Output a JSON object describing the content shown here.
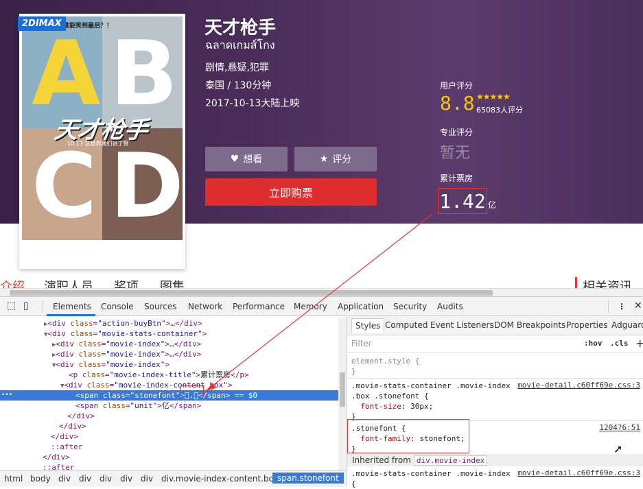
{
  "movie": {
    "badge": "2DIMAX",
    "poster_tagline": "谁能笑到最后？！",
    "poster_title": "天才枪手",
    "poster_date": "10.13 这世界我们说了算",
    "poster_letters": [
      "A",
      "B",
      "C",
      "D"
    ],
    "title_cn": "天才枪手",
    "title_th": "ฉลาดเกมส์โกง",
    "genres": "剧情,悬疑,犯罪",
    "country_runtime": "泰国 / 130分钟",
    "release": "2017-10-13大陆上映",
    "want_btn": "想看",
    "rate_btn": "评分",
    "buy_btn": "立即购票",
    "user_score_label": "用户评分",
    "user_score": "8.8",
    "stars": "★★★★★",
    "score_count": "65083人评分",
    "pro_score_label": "专业评分",
    "pro_score": "暂无",
    "boxoffice_label": "累计票房",
    "boxoffice": "1.42",
    "boxoffice_unit": "亿"
  },
  "page_tabs": [
    "介绍",
    "演职人员",
    "奖项",
    "图集",
    "相关资讯"
  ],
  "devtools": {
    "tabs": [
      "Elements",
      "Console",
      "Sources",
      "Network",
      "Performance",
      "Memory",
      "Application",
      "Security",
      "Audits"
    ],
    "dom": [
      {
        "tri": "▶",
        "indent": 64,
        "tag": "div",
        "cls": "action-buyBtn",
        "rest": "…</div>"
      },
      {
        "tri": "▼",
        "indent": 64,
        "tag": "div",
        "cls": "movie-stats-container",
        "rest": ""
      },
      {
        "tri": "▶",
        "indent": 76,
        "tag": "div",
        "cls": "movie-index",
        "rest": "…</div>"
      },
      {
        "tri": "▶",
        "indent": 76,
        "tag": "div",
        "cls": "movie-index",
        "rest": "…</div>"
      },
      {
        "tri": "▼",
        "indent": 76,
        "tag": "div",
        "cls": "movie-index",
        "rest": ""
      },
      {
        "tri": "",
        "indent": 100,
        "tag": "p",
        "cls": "movie-index-title",
        "text": "累计票房",
        "rest": "</p>"
      },
      {
        "tri": "▼",
        "indent": 88,
        "tag": "div",
        "cls": "movie-index-content box",
        "rest": ""
      },
      {
        "tri": "",
        "indent": 110,
        "tag": "span",
        "cls": "stonefont",
        "text": ".",
        "rest": "</span> == $0",
        "selected": true
      },
      {
        "tri": "",
        "indent": 110,
        "tag": "span",
        "cls": "unit",
        "text": "亿",
        "rest": "</span>"
      },
      {
        "tri": "",
        "indent": 98,
        "close": "</div>"
      },
      {
        "tri": "",
        "indent": 86,
        "close": "</div>"
      },
      {
        "tri": "",
        "indent": 74,
        "close": "</div>"
      },
      {
        "tri": "",
        "indent": 74,
        "close": "::after"
      },
      {
        "tri": "",
        "indent": 62,
        "close": "</div>"
      },
      {
        "tri": "",
        "indent": 62,
        "close": "::after"
      }
    ],
    "breadcrumb": [
      "html",
      "body",
      "div",
      "div",
      "div",
      "div",
      "div",
      "div.movie-index-content.box",
      "span.stonefont"
    ],
    "style_tabs": [
      "Styles",
      "Computed",
      "Event Listeners",
      "DOM Breakpoints",
      "Properties",
      "Adguard"
    ],
    "filter_placeholder": "Filter",
    "hov": ":hov",
    "cls": ".cls",
    "rules": {
      "element_style": "element.style {",
      "r1_selector": ".movie-stats-container .movie-index",
      "r1_selector2": ".box .stonefont {",
      "r1_src": "movie-detail.c60ff69e.css:3",
      "r1_prop": "font-size",
      "r1_val": "30px;",
      "r2_selector": ".stonefont {",
      "r2_src": "1204?6:51",
      "r2_prop": "font-family",
      "r2_val": "stonefont;",
      "inherited_label": "Inherited from",
      "inherited_tag": "div.movie-index",
      "r3_selector": ".movie-stats-container .movie-index",
      "r3_src": "movie-detail.c60ff69e.css:3"
    }
  }
}
